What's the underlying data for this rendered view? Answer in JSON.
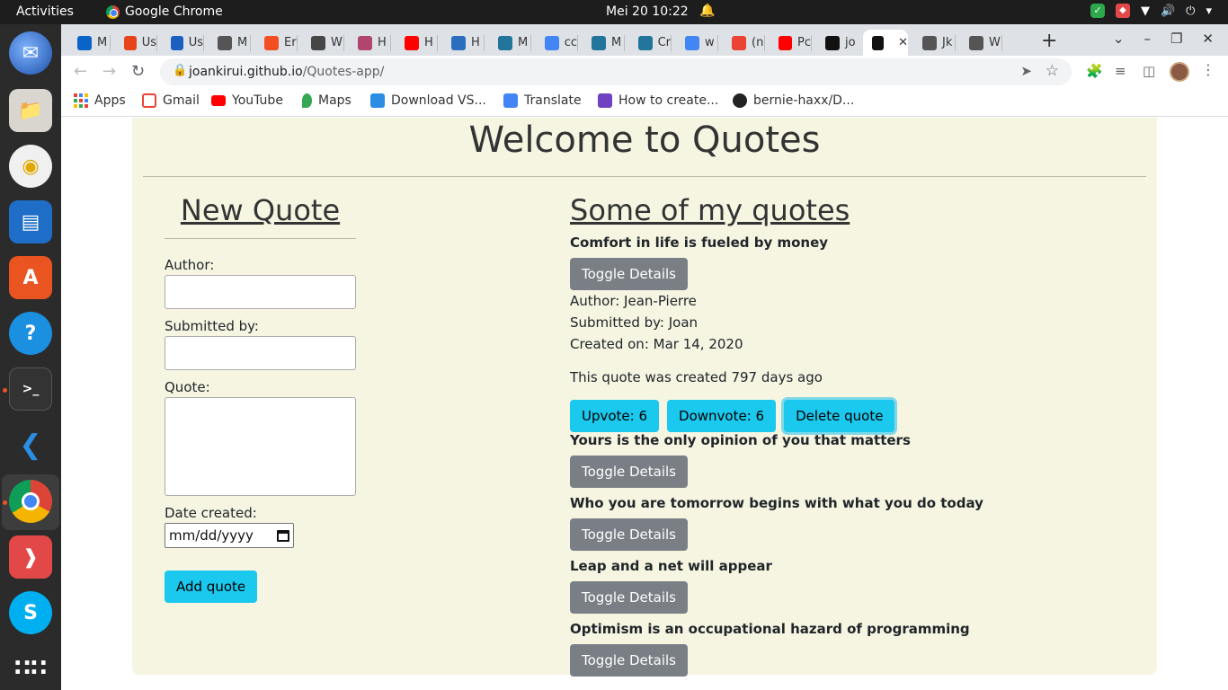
{
  "topbar": {
    "activities": "Activities",
    "app_name": "Google Chrome",
    "clock": "Mei 20  10:22"
  },
  "tabs": [
    {
      "label": "M",
      "favicon_color": "#0a64c8"
    },
    {
      "label": "Us",
      "favicon_color": "#e8441c"
    },
    {
      "label": "Us",
      "favicon_color": "#1b5fc1"
    },
    {
      "label": "M",
      "favicon_color": "#555"
    },
    {
      "label": "Er",
      "favicon_color": "#f25022"
    },
    {
      "label": "W",
      "favicon_color": "#464646"
    },
    {
      "label": "H",
      "favicon_color": "#b0466c"
    },
    {
      "label": "H",
      "favicon_color": "#ff0000"
    },
    {
      "label": "H",
      "favicon_color": "#2a6ebd"
    },
    {
      "label": "M",
      "favicon_color": "#21759b"
    },
    {
      "label": "cc",
      "favicon_color": "#4285f4"
    },
    {
      "label": "M",
      "favicon_color": "#21759b"
    },
    {
      "label": "Cr",
      "favicon_color": "#21759b"
    },
    {
      "label": "w",
      "favicon_color": "#4285f4"
    },
    {
      "label": "(n",
      "favicon_color": "#ea4335"
    },
    {
      "label": "Pc",
      "favicon_color": "#ff0000"
    },
    {
      "label": "jo",
      "favicon_color": "#111"
    },
    {
      "label": "",
      "favicon_color": "#111",
      "active": true
    },
    {
      "label": "Jk",
      "favicon_color": "#555"
    },
    {
      "label": "W",
      "favicon_color": "#555"
    }
  ],
  "address": {
    "host": "joankirui.github.io",
    "path": "/Quotes-app/"
  },
  "bookmarks": [
    {
      "label": "Apps"
    },
    {
      "label": "Gmail"
    },
    {
      "label": "YouTube"
    },
    {
      "label": "Maps"
    },
    {
      "label": "Download VS..."
    },
    {
      "label": "Translate"
    },
    {
      "label": "How to create..."
    },
    {
      "label": "bernie-haxx/D..."
    }
  ],
  "page": {
    "title": "Welcome to Quotes",
    "form": {
      "heading": "New Quote",
      "author_label": "Author:",
      "submitted_label": "Submitted by:",
      "quote_label": "Quote:",
      "date_label": "Date created:",
      "date_placeholder": "mm/dd/yyyy",
      "add_button": "Add quote"
    },
    "quotes": {
      "heading": "Some of my quotes",
      "toggle_label": "Toggle Details",
      "first": {
        "text": "Comfort in life is fueled by money",
        "author": "Author: Jean-Pierre",
        "submitted": "Submitted by: Joan",
        "created": "Created on: Mar 14, 2020",
        "days_ago": "This quote was created 797 days ago",
        "upvote": "Upvote: 6",
        "downvote": "Downvote: 6",
        "delete": "Delete quote"
      },
      "others": [
        "Yours is the only opinion of you that matters",
        "Who you are tomorrow begins with what you do today",
        "Leap and a net will appear",
        "Optimism is an occupational hazard of programming"
      ]
    }
  },
  "colors": {
    "card_bg": "#f5f5e2",
    "info_btn": "#1bc8ee",
    "secondary_btn": "#7a7f85"
  }
}
